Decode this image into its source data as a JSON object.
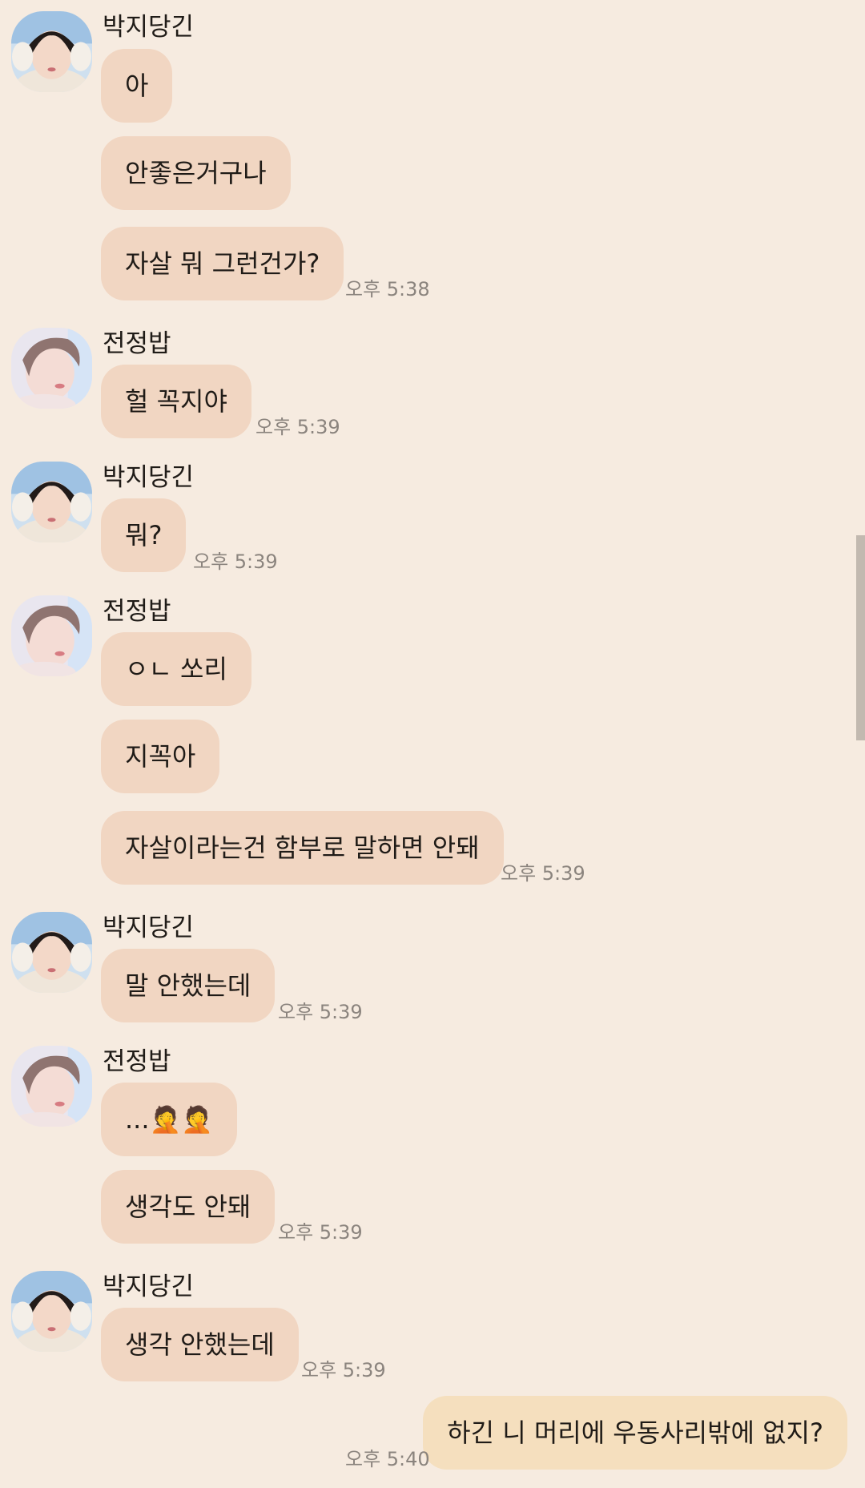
{
  "participants": {
    "jimin": {
      "name": "박지당긴"
    },
    "jungkook": {
      "name": "전정밥"
    }
  },
  "icons": {
    "jimin_avatar": "avatar-photo-icon",
    "jungkook_avatar": "avatar-photo-icon",
    "facepalm_emoji": "🤦"
  },
  "colors": {
    "background": "#f6ebe0",
    "incoming_bubble": "#f1d6c2",
    "outgoing_bubble": "#f5dfbe",
    "timestamp": "#8b847e"
  },
  "messages": {
    "g1_sender": "박지당긴",
    "g1_m1": "아",
    "g1_m2": "안좋은거구나",
    "g1_m3": "자살 뭐 그런건가?",
    "g1_time": "오후 5:38",
    "g2_sender": "전정밥",
    "g2_m1": "헐 꼭지야",
    "g2_time": "오후 5:39",
    "g3_sender": "박지당긴",
    "g3_m1": "뭐?",
    "g3_time": "오후 5:39",
    "g4_sender": "전정밥",
    "g4_m1": "ㅇㄴ 쏘리",
    "g4_m2": "지꼭아",
    "g4_m3": "자살이라는건 함부로 말하면 안돼",
    "g4_time": "오후 5:39",
    "g5_sender": "박지당긴",
    "g5_m1": "말 안했는데",
    "g5_time": "오후 5:39",
    "g6_sender": "전정밥",
    "g6_m1": "...🤦🤦",
    "g6_m2": "생각도 안돼",
    "g6_time": "오후 5:39",
    "g7_sender": "박지당긴",
    "g7_m1": "생각 안했는데",
    "g7_time": "오후 5:39",
    "out_m1": "하긴 니 머리에 우동사리밖에 없지?",
    "out_time": "오후 5:40"
  }
}
